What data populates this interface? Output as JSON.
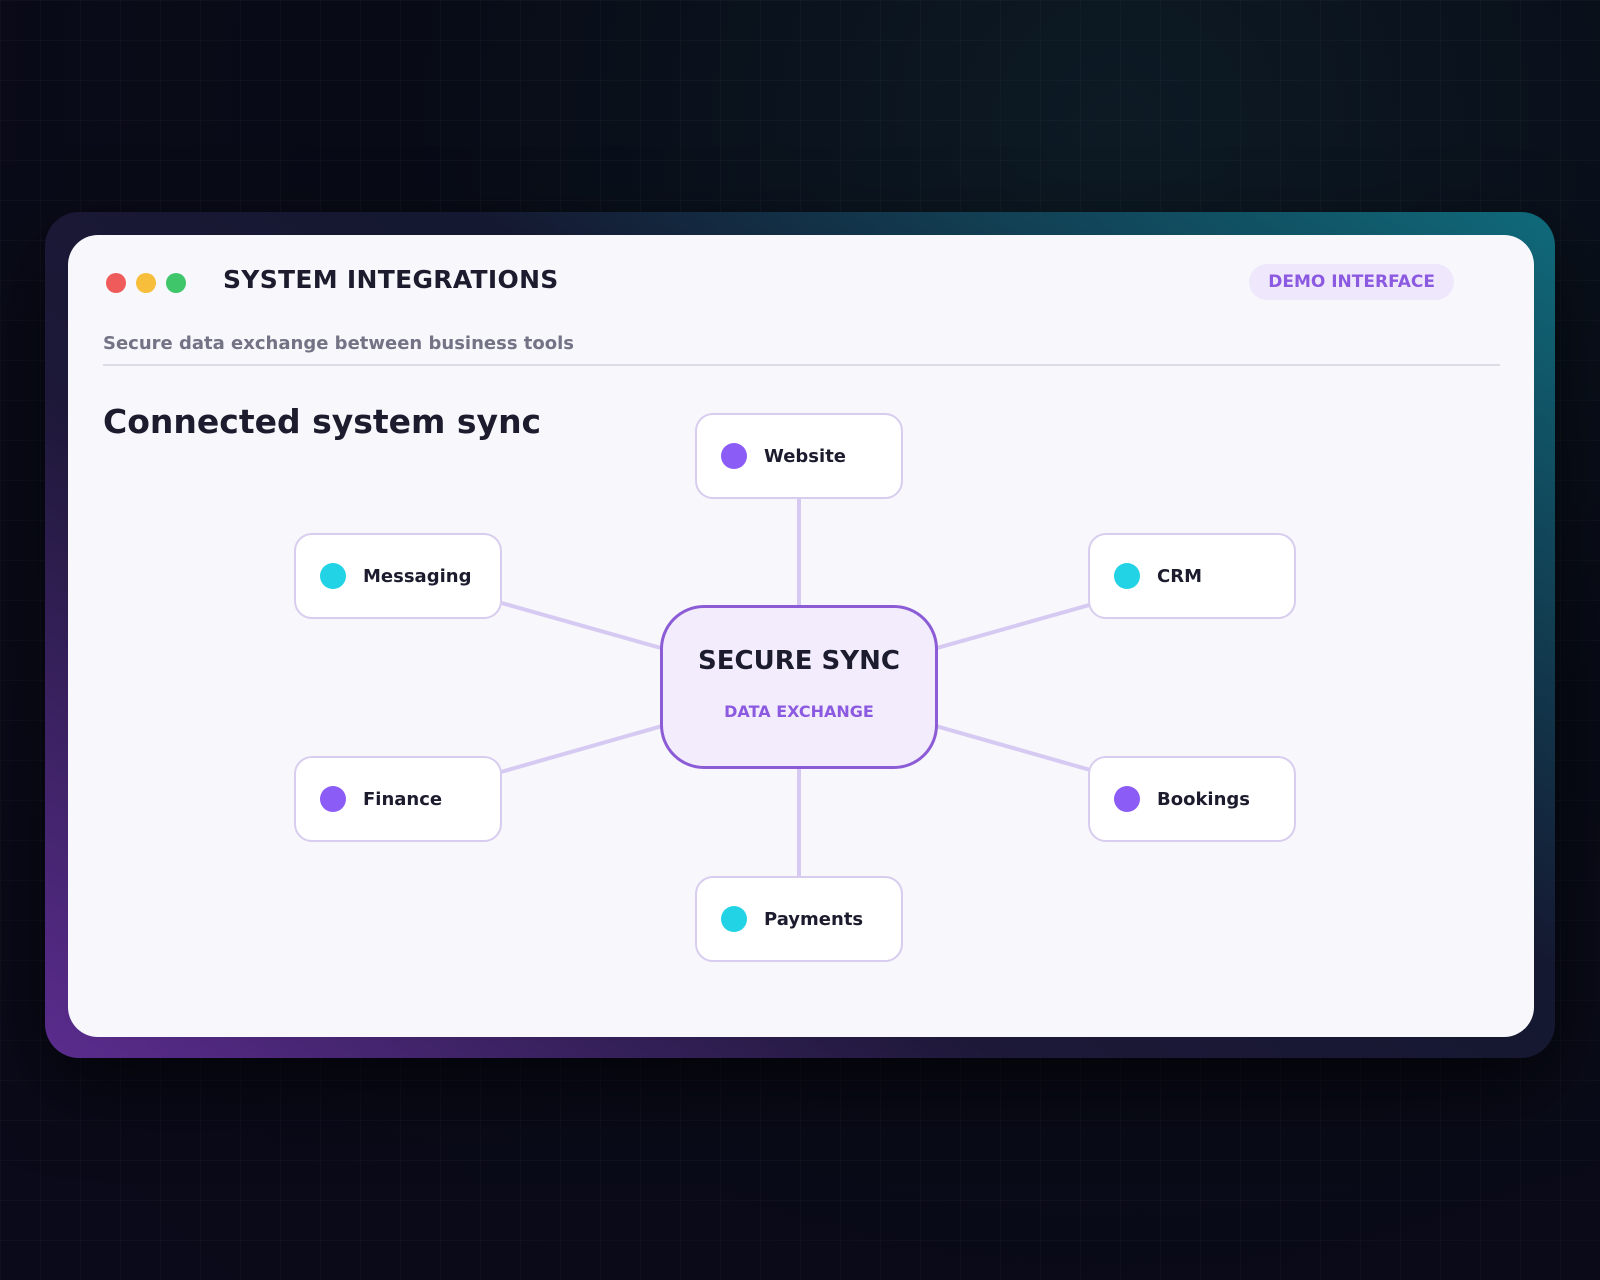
{
  "window": {
    "title": "SYSTEM INTEGRATIONS",
    "badge": "DEMO INTERFACE",
    "subtitle": "Secure data exchange between business tools",
    "controls": [
      "close",
      "minimize",
      "maximize"
    ]
  },
  "diagram": {
    "title": "Connected system sync",
    "hub": {
      "title": "SECURE SYNC",
      "subtitle": "DATA EXCHANGE"
    },
    "nodes": [
      {
        "id": "website",
        "label": "Website",
        "dot_color": "#8b5cf6"
      },
      {
        "id": "crm",
        "label": "CRM",
        "dot_color": "#22d3e6"
      },
      {
        "id": "bookings",
        "label": "Bookings",
        "dot_color": "#8b5cf6"
      },
      {
        "id": "payments",
        "label": "Payments",
        "dot_color": "#22d3e6"
      },
      {
        "id": "finance",
        "label": "Finance",
        "dot_color": "#8b5cf6"
      },
      {
        "id": "messaging",
        "label": "Messaging",
        "dot_color": "#22d3e6"
      }
    ],
    "edges": [
      [
        "hub",
        "website"
      ],
      [
        "hub",
        "crm"
      ],
      [
        "hub",
        "bookings"
      ],
      [
        "hub",
        "payments"
      ],
      [
        "hub",
        "finance"
      ],
      [
        "hub",
        "messaging"
      ]
    ]
  },
  "colors": {
    "accent": "#8c5ae0",
    "link": "#d6caf2",
    "close": "#ef5b5b",
    "minimize": "#f6be3b",
    "maximize": "#3fc66b"
  }
}
